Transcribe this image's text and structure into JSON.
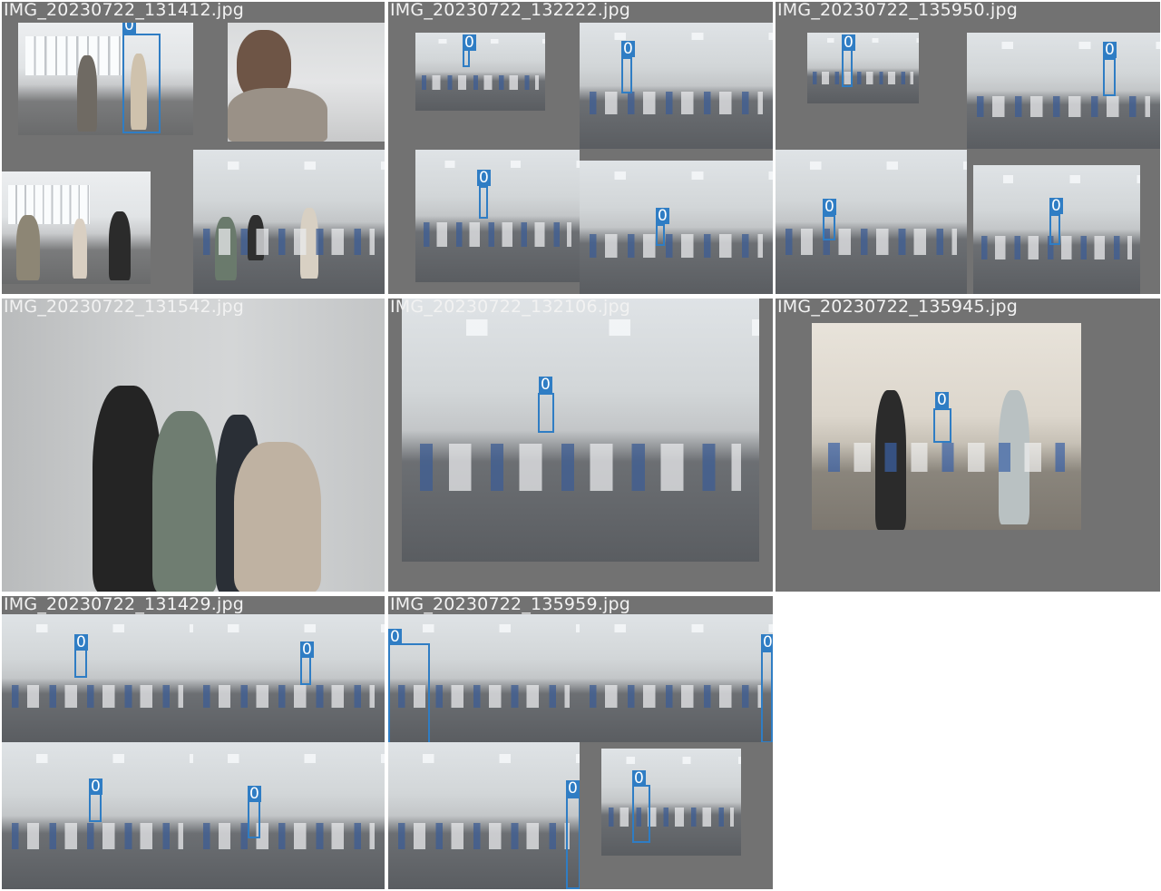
{
  "tiles": [
    {
      "filename": "IMG_20230722_131412.jpg"
    },
    {
      "filename": "IMG_20230722_132222.jpg"
    },
    {
      "filename": "IMG_20230722_135950.jpg"
    },
    {
      "filename": "IMG_20230722_131542.jpg"
    },
    {
      "filename": "IMG_20230722_132106.jpg"
    },
    {
      "filename": "IMG_20230722_135945.jpg"
    },
    {
      "filename": "IMG_20230722_131429.jpg"
    },
    {
      "filename": "IMG_20230722_135959.jpg"
    }
  ],
  "class_label": "0",
  "colors": {
    "box": "#2f7dc4",
    "padding": "#727272",
    "background": "#ffffff"
  }
}
